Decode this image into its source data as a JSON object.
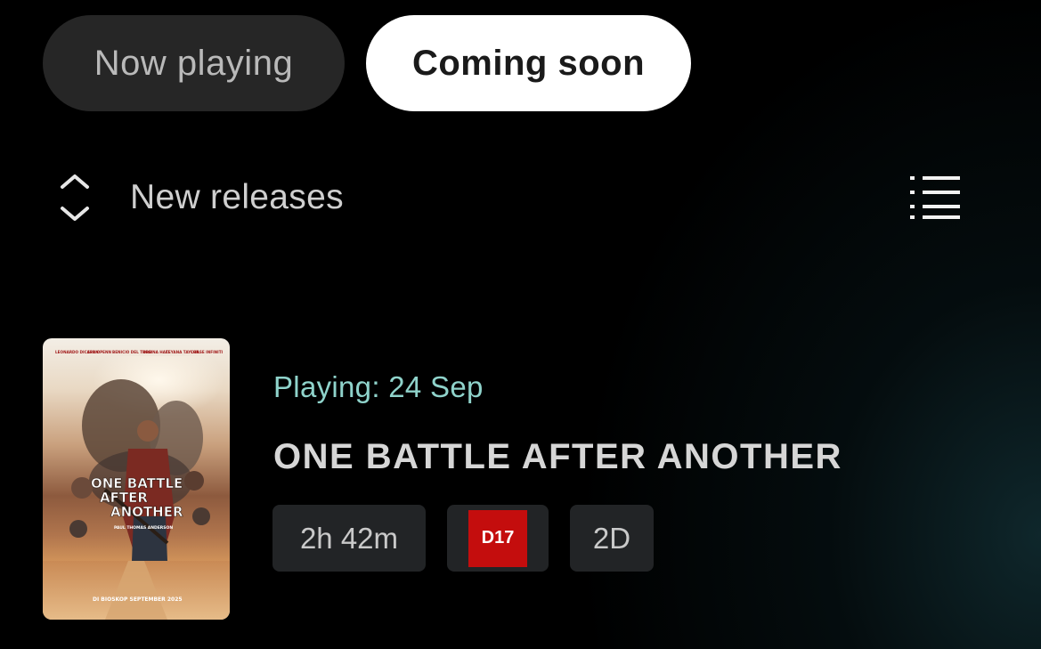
{
  "tabs": {
    "now_playing": "Now playing",
    "coming_soon": "Coming soon",
    "active": "coming_soon"
  },
  "sort": {
    "icon": "sort-up-down-icon",
    "label": "New releases"
  },
  "view_toggle": {
    "icon": "list-view-icon"
  },
  "movies": [
    {
      "playing_date": "Playing: 24 Sep",
      "title": "ONE BATTLE AFTER ANOTHER",
      "duration": "2h 42m",
      "rating": "D17",
      "format": "2D",
      "poster": {
        "cast": [
          "LEONARDO DICAPRIO",
          "SEAN PENN",
          "BENICIO DEL TORO",
          "REGINA HALL",
          "TEYANA TAYLOR",
          "CHASE INFINITI"
        ],
        "title_line1": "ONE BATTLE",
        "title_line2": "AFTER",
        "title_line3": "ANOTHER",
        "director": "PAUL THOMAS ANDERSON",
        "release": "DI BIOSKOP SEPTEMBER 2025"
      }
    }
  ],
  "colors": {
    "background": "#000000",
    "accent_teal": "#8fd3cb",
    "rating_red": "#c40d0d",
    "tab_active_bg": "#ffffff",
    "tab_inactive_bg": "#262626"
  }
}
